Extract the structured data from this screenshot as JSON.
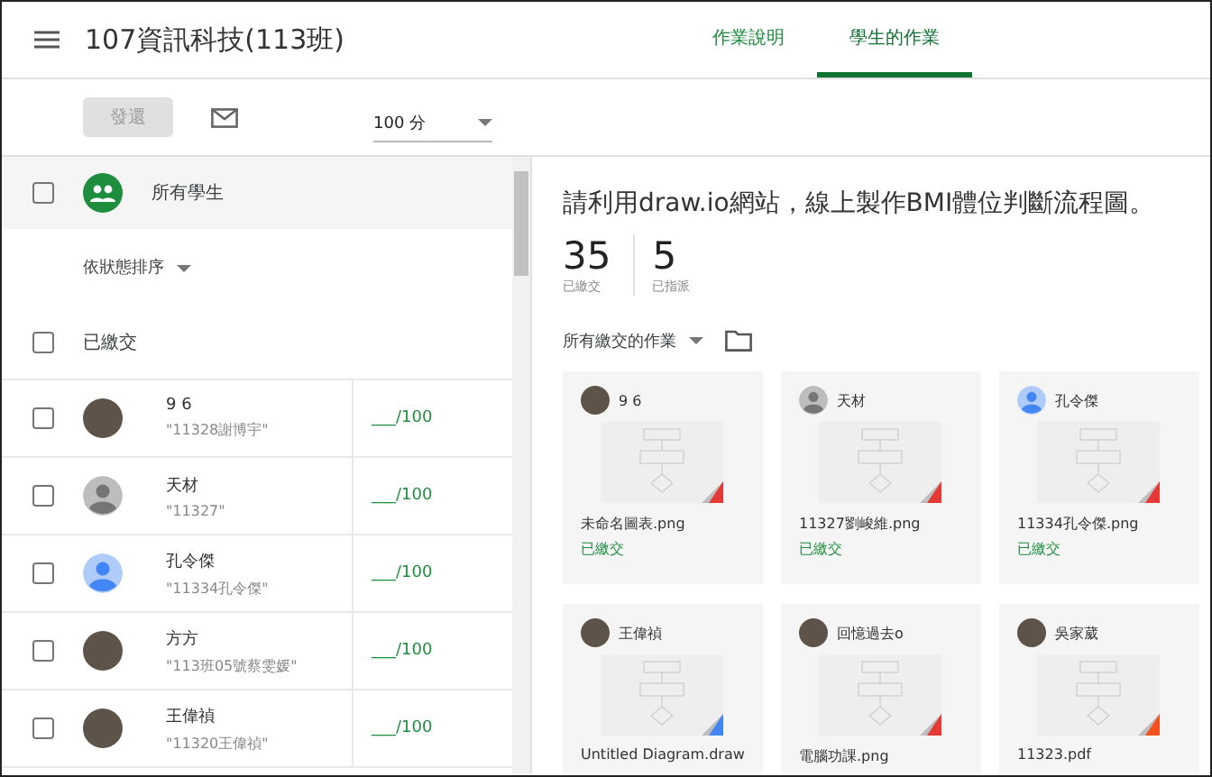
{
  "header": {
    "title": "107資訊科技(113班)",
    "tabs": [
      {
        "label": "作業說明",
        "selected": false
      },
      {
        "label": "學生的作業",
        "selected": true
      }
    ]
  },
  "toolbar": {
    "return_button": {
      "label": "發還",
      "disabled": true
    },
    "points": "100 分"
  },
  "students": {
    "all_label": "所有學生",
    "all_checked": false,
    "sort_label": "依狀態排序",
    "group_label": "已繳交",
    "group_checked": false,
    "rows": [
      {
        "name": "9 6",
        "note": "\"11328謝博宇\"",
        "grade": "___/100",
        "kind": "photo",
        "checked": false
      },
      {
        "name": "天材",
        "note": "\"11327\"",
        "grade": "___/100",
        "kind": "default",
        "checked": false
      },
      {
        "name": "孔令傑",
        "note": "\"11334孔令傑\"",
        "grade": "___/100",
        "kind": "blue",
        "checked": false
      },
      {
        "name": "方方",
        "note": "\"113班05號蔡雯媛\"",
        "grade": "___/100",
        "kind": "photo",
        "checked": false
      },
      {
        "name": "王偉禎",
        "note": "\"11320王偉禎\"",
        "grade": "___/100",
        "kind": "photo",
        "checked": false
      }
    ]
  },
  "assignment": {
    "title": "請利用draw.io網站，線上製作BMI體位判斷流程圖。",
    "stats": [
      {
        "value": "35",
        "label": "已繳交"
      },
      {
        "value": "5",
        "label": "已指派"
      }
    ],
    "filter": "所有繳交的作業",
    "cards": [
      {
        "name": "9 6",
        "kind": "photo",
        "file": "未命名圖表.png",
        "status": "已繳交",
        "color": "#e53935"
      },
      {
        "name": "天材",
        "kind": "default",
        "file": "11327劉峻維.png",
        "status": "已繳交",
        "color": "#e53935"
      },
      {
        "name": "孔令傑",
        "kind": "blue",
        "file": "11334孔令傑.png",
        "status": "已繳交",
        "color": "#e53935"
      },
      {
        "name": "王偉禎",
        "kind": "photo",
        "file": "Untitled Diagram.draw",
        "color": "#4285f4"
      },
      {
        "name": "回憶過去o",
        "kind": "photo",
        "file": "電腦功課.png",
        "color": "#e53935"
      },
      {
        "name": "吳家葳",
        "kind": "photo",
        "file": "11323.pdf",
        "color": "#f4511e"
      }
    ]
  }
}
